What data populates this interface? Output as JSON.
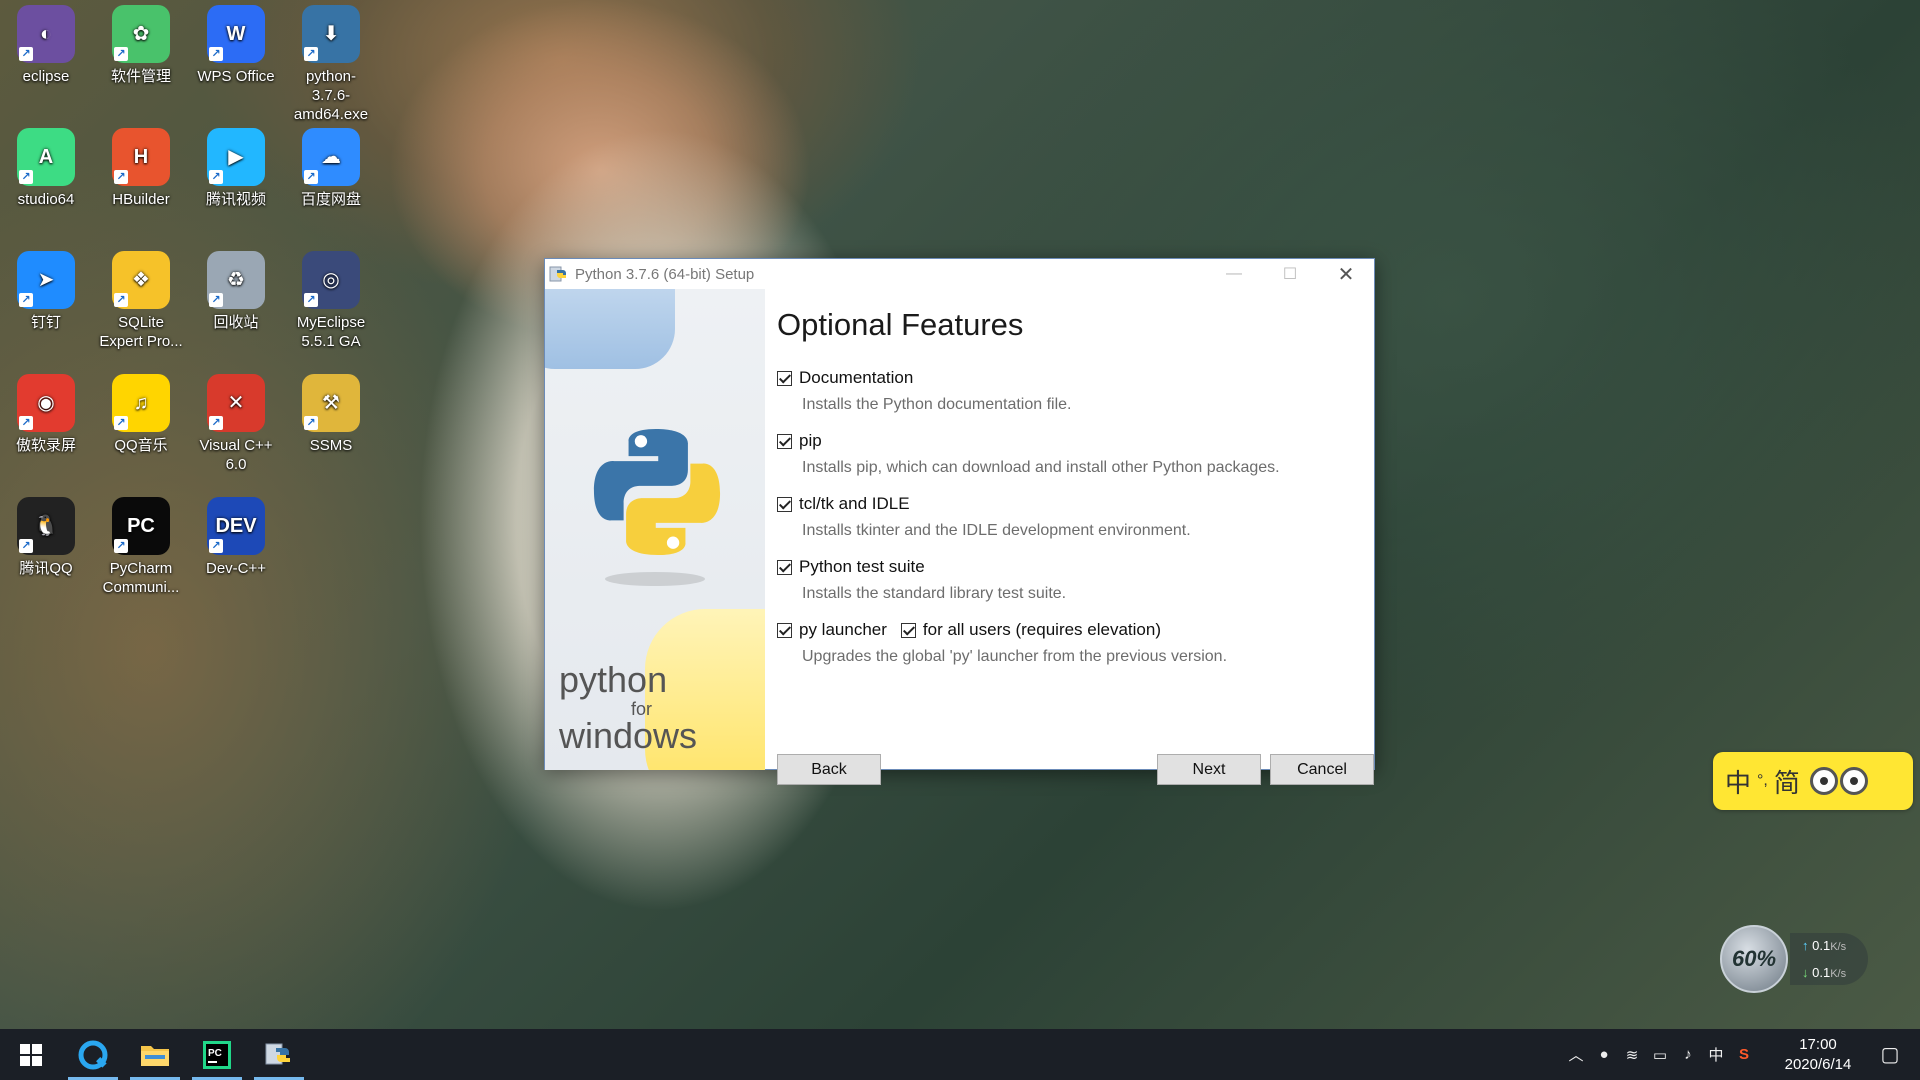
{
  "desktop": {
    "icons": [
      {
        "label": "eclipse",
        "icon": "eclipse-icon",
        "color": "#6c4fa0"
      },
      {
        "label": "studio64",
        "icon": "android-studio-icon",
        "color": "#3ddc84"
      },
      {
        "label": "钉钉",
        "icon": "dingtalk-icon",
        "color": "#1f8cff"
      },
      {
        "label": "傲软录屏",
        "icon": "screen-recorder-icon",
        "color": "#e23b2f"
      },
      {
        "label": "腾讯QQ",
        "icon": "qq-icon",
        "color": "#222222"
      },
      {
        "label": "软件管理",
        "icon": "software-manager-icon",
        "color": "#49c26b"
      },
      {
        "label": "HBuilder",
        "icon": "hbuilder-icon",
        "color": "#e8542e"
      },
      {
        "label": "SQLite Expert Pro...",
        "icon": "sqlite-expert-icon",
        "color": "#f6c229"
      },
      {
        "label": "QQ音乐",
        "icon": "qq-music-icon",
        "color": "#ffd500"
      },
      {
        "label": "PyCharm Communi...",
        "icon": "pycharm-icon",
        "color": "#0a0a0a"
      },
      {
        "label": "WPS Office",
        "icon": "wps-office-icon",
        "color": "#2c6cf5"
      },
      {
        "label": "腾讯视频",
        "icon": "tencent-video-icon",
        "color": "#22b7ff"
      },
      {
        "label": "回收站",
        "icon": "recycle-bin-icon",
        "color": "#9aa7b4"
      },
      {
        "label": "Visual C++ 6.0",
        "icon": "visual-cpp-icon",
        "color": "#d83a2c"
      },
      {
        "label": "Dev-C++",
        "icon": "dev-cpp-icon",
        "color": "#1d49b7"
      },
      {
        "label": "python-3.7.6-amd64.exe",
        "icon": "python-installer-icon",
        "color": "#3773a5"
      },
      {
        "label": "百度网盘",
        "icon": "baidu-netdisk-icon",
        "color": "#2f8cff"
      },
      {
        "label": "MyEclipse 5.5.1 GA",
        "icon": "myeclipse-icon",
        "color": "#3a4a7a"
      },
      {
        "label": "SSMS",
        "icon": "ssms-icon",
        "color": "#e0b63b"
      }
    ]
  },
  "window": {
    "title": "Python 3.7.6 (64-bit) Setup",
    "minimize": "—",
    "maximize": "☐",
    "close": "✕",
    "side_text_1": "python",
    "side_text_2": "for",
    "side_text_3": "windows",
    "page_title": "Optional Features",
    "features": [
      {
        "label": "Documentation",
        "desc": "Installs the Python documentation file.",
        "checked": true
      },
      {
        "label": "pip",
        "desc": "Installs pip, which can download and install other Python packages.",
        "checked": true
      },
      {
        "label": "tcl/tk and IDLE",
        "desc": "Installs tkinter and the IDLE development environment.",
        "checked": true
      },
      {
        "label": "Python test suite",
        "desc": "Installs the standard library test suite.",
        "checked": true
      },
      {
        "label": "py launcher",
        "desc": "Upgrades the global 'py' launcher from the previous version.",
        "checked": true
      }
    ],
    "all_users_label": "for all users (requires elevation)",
    "back_label": "Back",
    "next_label": "Next",
    "cancel_label": "Cancel"
  },
  "ime": {
    "mode": "中",
    "punct": "°,",
    "script": "简"
  },
  "netmon": {
    "percent": "60%",
    "up": "0.1",
    "down": "0.1",
    "unit": "K/s"
  },
  "taskbar": {
    "items": [
      "start-icon",
      "browser-icon",
      "file-explorer-icon",
      "pycharm-icon",
      "python-setup-icon"
    ],
    "lang": "中",
    "time": "17:00",
    "date": "2020/6/14"
  }
}
